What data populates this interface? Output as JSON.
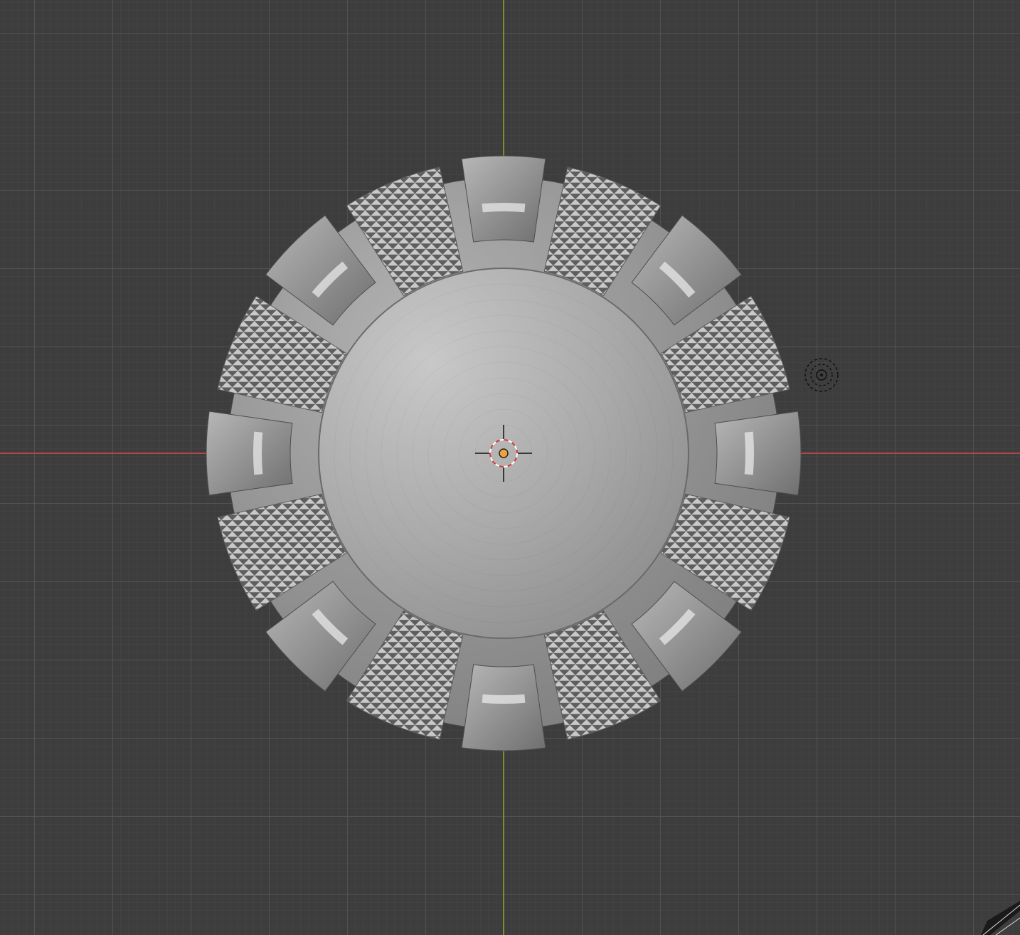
{
  "viewport": {
    "background_color": "#3d3d3d",
    "grid_color": "#545454",
    "axis_x_color": "#b4454d",
    "axis_y_color": "#76902d"
  },
  "object": {
    "type": "mesh",
    "shading": "solid",
    "base_color": "#a3a3a3",
    "segments": 16
  },
  "icons": {
    "cursor": "3d-cursor-icon",
    "light": "light-object-icon",
    "camera": "camera-object-icon",
    "origin": "object-origin-icon"
  },
  "origin_color": "#f2a13a"
}
